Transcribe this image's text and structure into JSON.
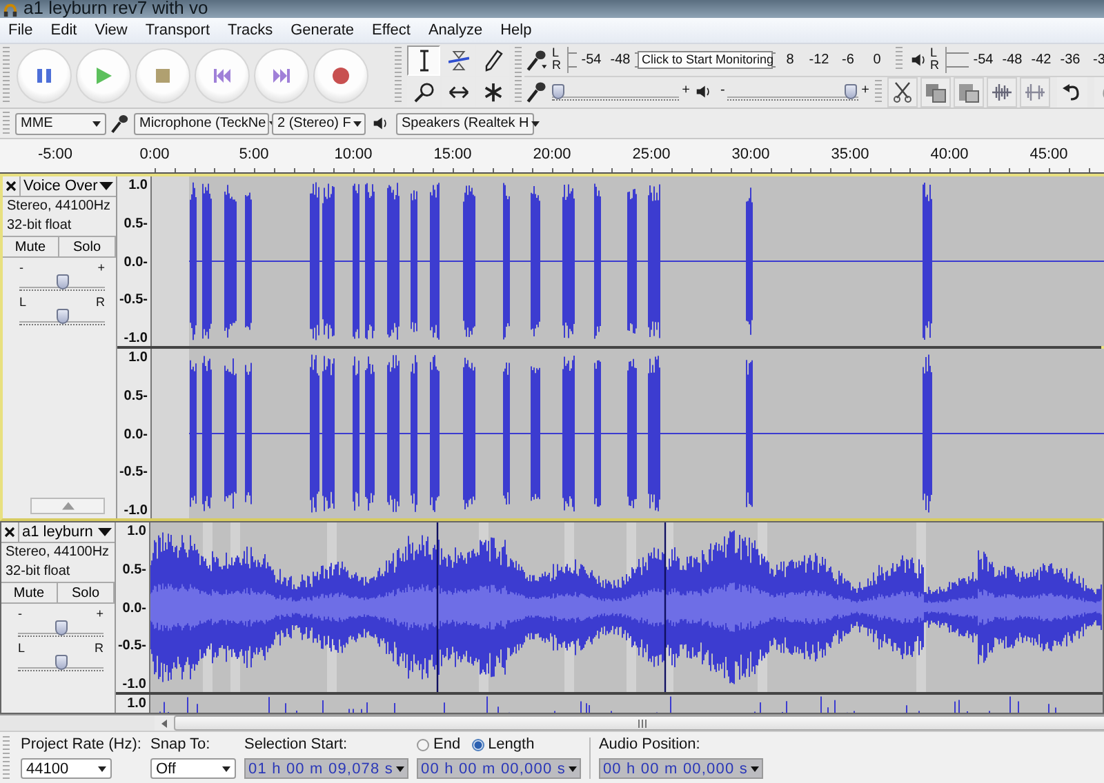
{
  "window": {
    "title": "a1 leyburn rev7 with vo"
  },
  "menu": [
    "File",
    "Edit",
    "View",
    "Transport",
    "Tracks",
    "Generate",
    "Effect",
    "Analyze",
    "Help"
  ],
  "transport": [
    {
      "kind": "pause"
    },
    {
      "kind": "play"
    },
    {
      "kind": "stop"
    },
    {
      "kind": "start"
    },
    {
      "kind": "end"
    },
    {
      "kind": "record"
    }
  ],
  "tools": [
    {
      "kind": "select",
      "selected": true
    },
    {
      "kind": "envelope",
      "selected": false
    },
    {
      "kind": "draw",
      "selected": false
    },
    {
      "kind": "zoom",
      "selected": false
    },
    {
      "kind": "timeshift",
      "selected": false
    },
    {
      "kind": "multi",
      "selected": false
    }
  ],
  "record_meter": {
    "left": "L",
    "right": "R",
    "ticks": [
      "-54",
      "-48"
    ],
    "tooltip": "Click to Start Monitoring",
    "ticks_after": [
      "8",
      "-12",
      "-6",
      "0"
    ]
  },
  "playback_meter": {
    "left": "L",
    "right": "R",
    "ticks": [
      "-54",
      "-48",
      "-42",
      "-36",
      "-3"
    ]
  },
  "mixer": {
    "record": {
      "max": "+",
      "level": 0.04
    },
    "playback": {
      "min": "-",
      "max": "+",
      "level": 0.93
    }
  },
  "edit_tools": [
    {
      "kind": "cut"
    },
    {
      "kind": "copy"
    },
    {
      "kind": "paste"
    },
    {
      "kind": "trim"
    },
    {
      "kind": "silence"
    },
    {
      "kind": "undo"
    },
    {
      "kind": "redo"
    }
  ],
  "devices": {
    "host": "MME",
    "input": "Microphone (TeckNe",
    "channels": "2 (Stereo) F",
    "output": "Speakers (Realtek H"
  },
  "ruler": [
    "-5:00",
    "0:00",
    "5:00",
    "10:00",
    "15:00",
    "20:00",
    "25:00",
    "30:00",
    "35:00",
    "40:00",
    "45:00"
  ],
  "tracks": [
    {
      "name": "Voice Over",
      "format": "Stereo, 44100Hz",
      "sample": "32-bit float",
      "mute": "Mute",
      "solo": "Solo",
      "gain": {
        "min": "-",
        "max": "+",
        "level": 0.5
      },
      "pan": {
        "left": "L",
        "right": "R",
        "level": 0.5
      },
      "focused": true,
      "kind": "voice",
      "collapse_button": true,
      "channels": [
        {
          "scale": [
            "1.0",
            "0.5-",
            "0.0-",
            "-0.5-",
            "-1.0"
          ]
        },
        {
          "scale": [
            "1.0",
            "0.5-",
            "0.0-",
            "-0.5-",
            "-1.0"
          ]
        }
      ]
    },
    {
      "name": "a1 leyburn",
      "format": "Stereo, 44100Hz",
      "sample": "32-bit float",
      "mute": "Mute",
      "solo": "Solo",
      "gain": {
        "min": "-",
        "max": "+",
        "level": 0.5
      },
      "pan": {
        "left": "L",
        "right": "R",
        "level": 0.5
      },
      "focused": false,
      "kind": "music",
      "channels": [
        {
          "scale": [
            "1.0",
            "0.5-",
            "0.0-",
            "-0.5-",
            "-1.0"
          ]
        },
        {
          "scale": [
            "1.0"
          ]
        }
      ]
    }
  ],
  "selection_bar": {
    "rate_label": "Project Rate (Hz):",
    "rate": "44100",
    "snap_label": "Snap To:",
    "snap": "Off",
    "start_label": "Selection Start:",
    "start": "01 h 00 m 09,078 s",
    "modes": [
      {
        "label": "End",
        "selected": false
      },
      {
        "label": "Length",
        "selected": true
      }
    ],
    "length": "00 h 00 m 00,000 s",
    "position_label": "Audio Position:",
    "position": "00 h 00 m 00,000 s"
  }
}
